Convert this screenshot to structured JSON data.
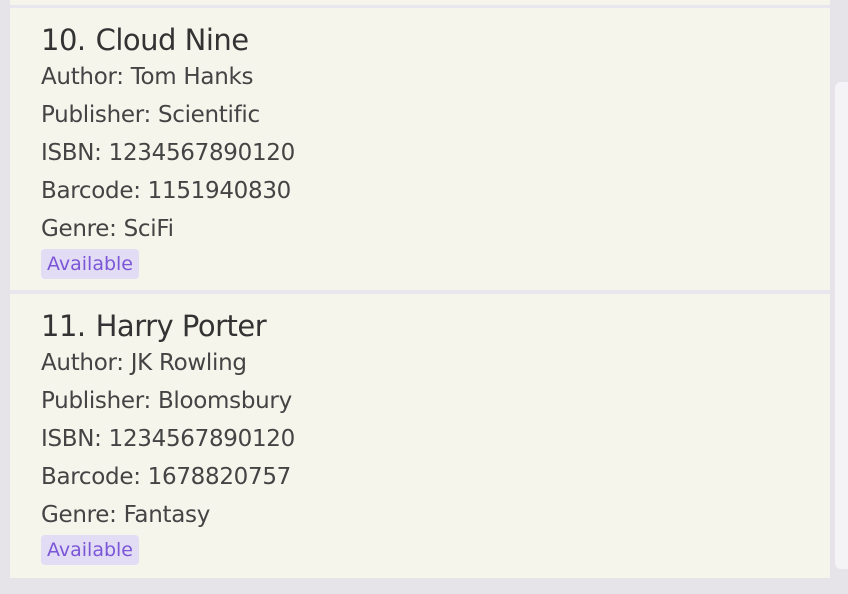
{
  "books": [
    {
      "index": "10.",
      "title": "Cloud Nine",
      "author": "Author: Tom Hanks",
      "publisher": "Publisher: Scientific",
      "isbn": "ISBN: 1234567890120",
      "barcode": "Barcode: 1151940830",
      "genre": "Genre: SciFi",
      "status": "Available"
    },
    {
      "index": "11.",
      "title": "Harry Porter",
      "author": "Author: JK Rowling",
      "publisher": "Publisher: Bloomsbury",
      "isbn": "ISBN: 1234567890120",
      "barcode": "Barcode: 1678820757",
      "genre": "Genre: Fantasy",
      "status": "Available"
    }
  ],
  "colors": {
    "card_background": "#f6f5ec",
    "separator": "#e8e6ef",
    "badge_text": "#7b56d6",
    "badge_background": "#e2dcf5"
  }
}
